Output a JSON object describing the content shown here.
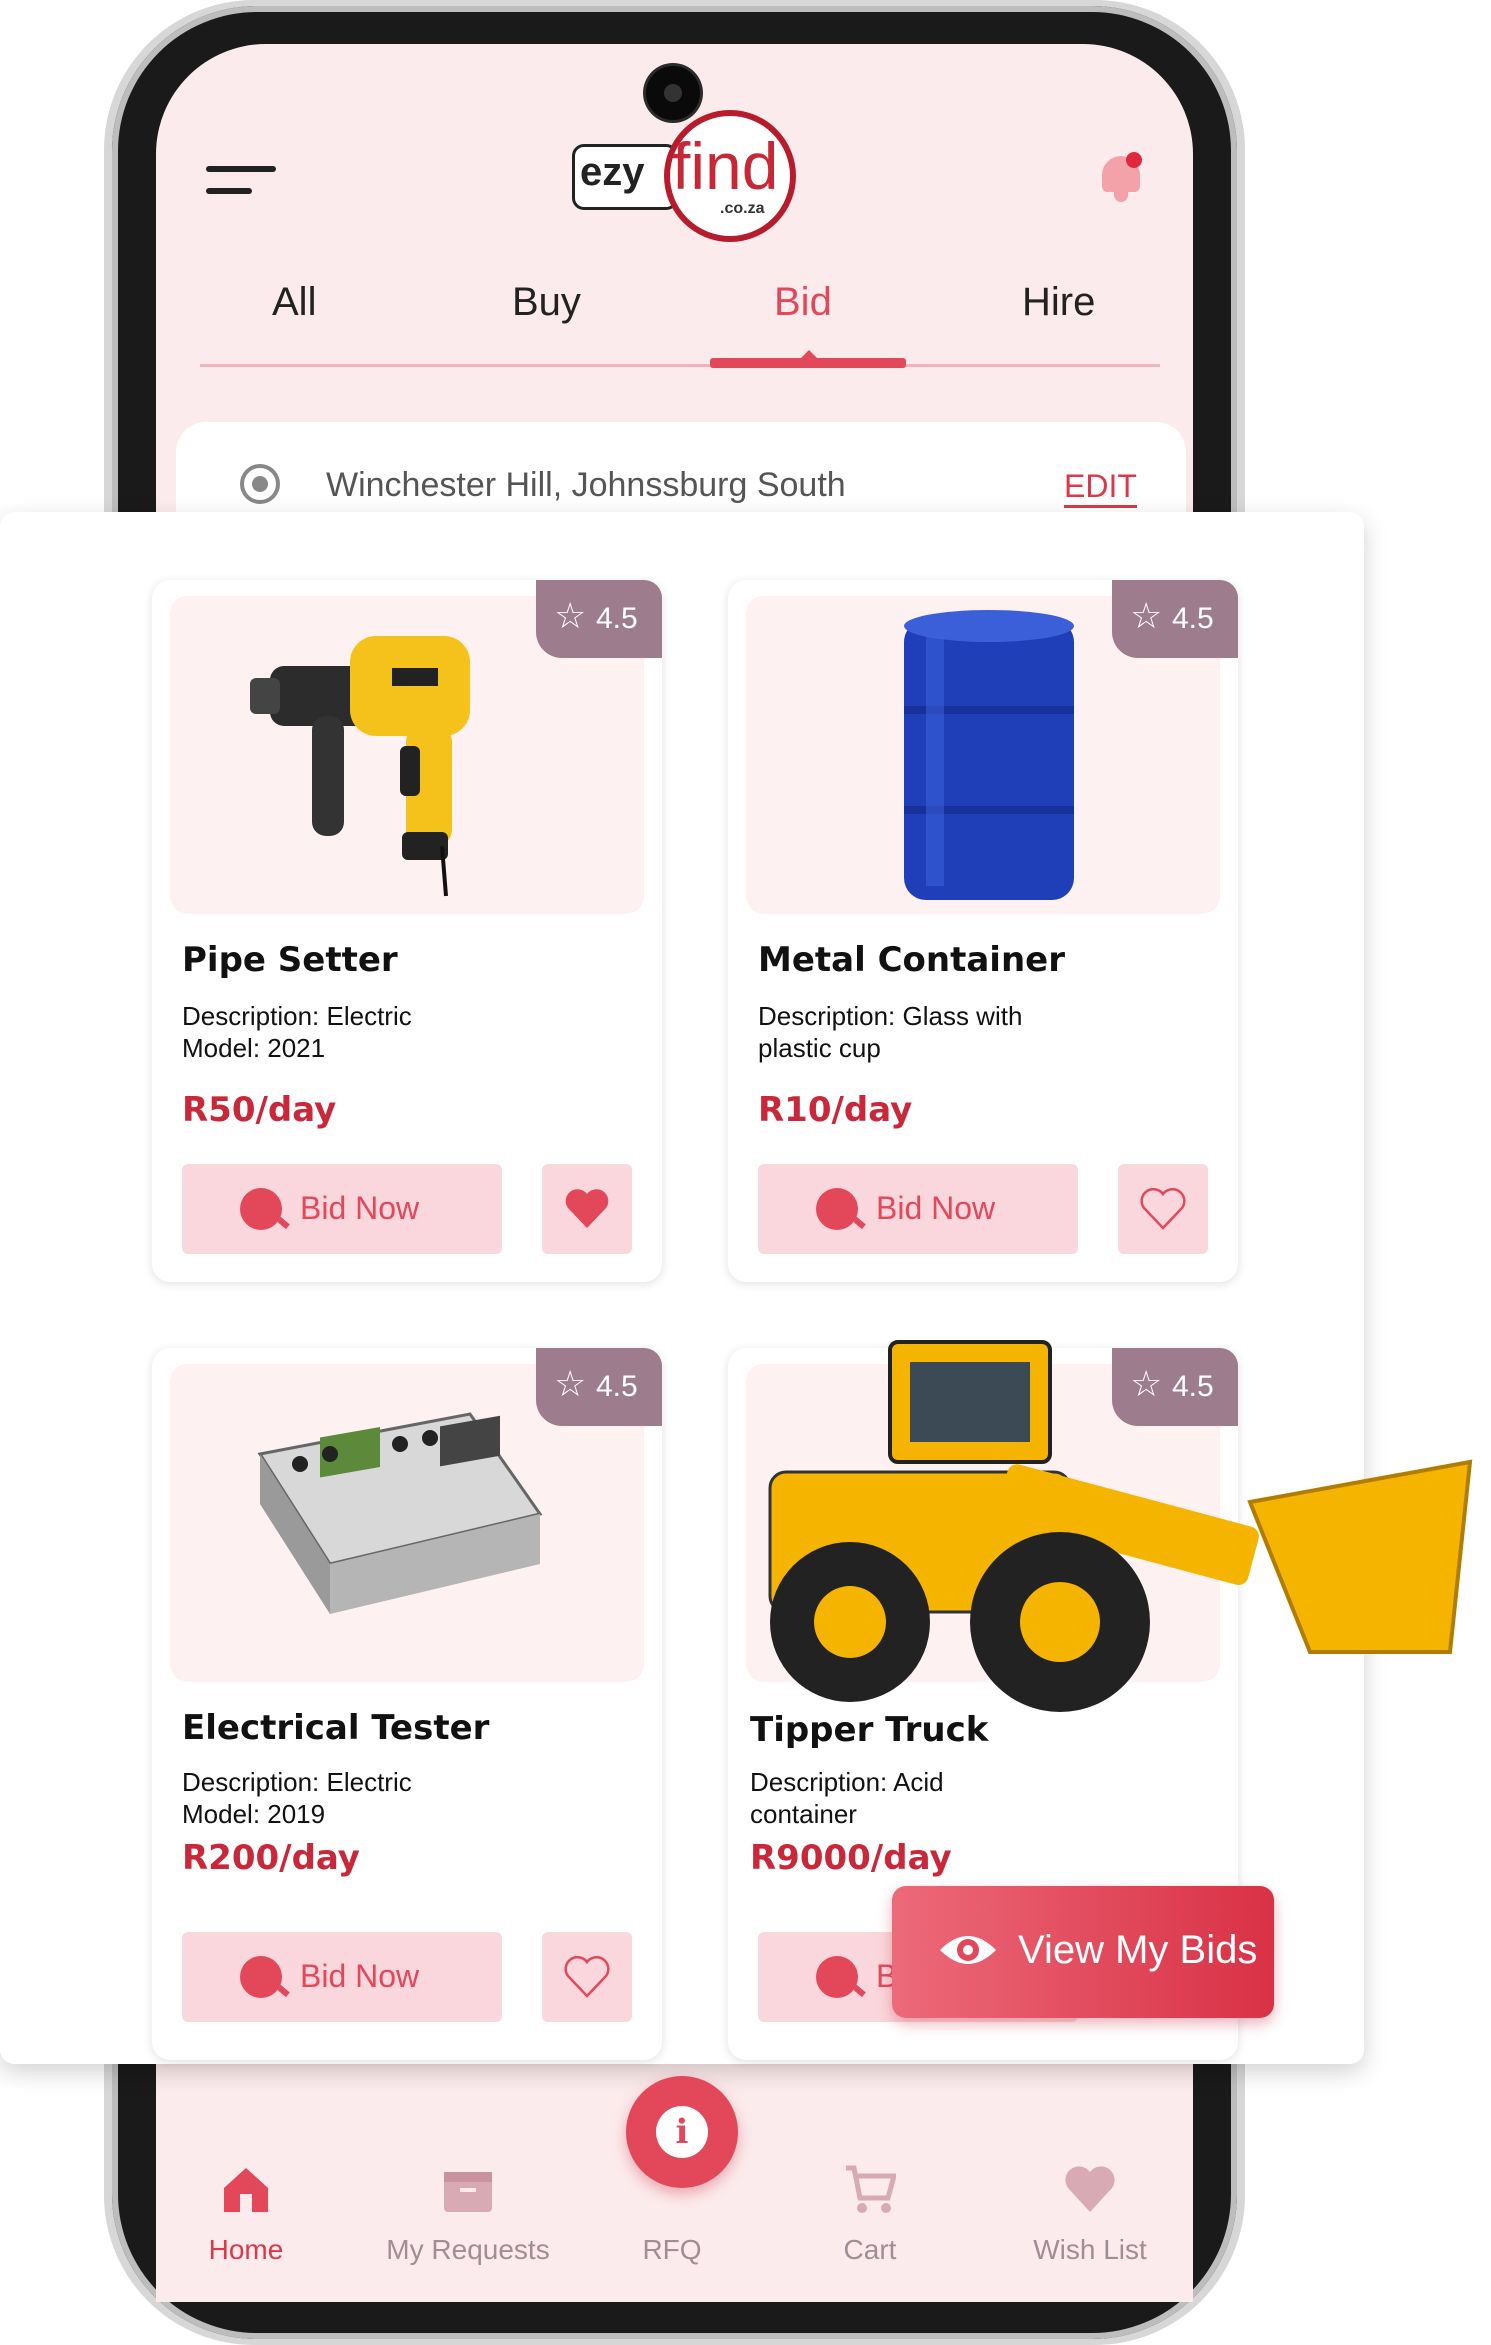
{
  "header": {
    "logo": {
      "ezy": "ezy",
      "find": "find",
      "coza": ".co.za"
    }
  },
  "tabs": [
    {
      "label": "All"
    },
    {
      "label": "Buy"
    },
    {
      "label": "Bid",
      "active": true
    },
    {
      "label": "Hire"
    }
  ],
  "location": {
    "text": "Winchester Hill, Johnssburg South",
    "edit_label": "EDIT"
  },
  "products": [
    {
      "title": "Pipe Setter",
      "desc_line1": "Description: Electric",
      "desc_line2": "Model: 2021",
      "price": "R50/day",
      "rating": "4.5",
      "bid_label": "Bid Now",
      "favorited": true,
      "image_icon": "hammer-drill-icon"
    },
    {
      "title": "Metal Container",
      "desc_line1": "Description: Glass with",
      "desc_line2": "plastic cup",
      "price": "R10/day",
      "rating": "4.5",
      "bid_label": "Bid Now",
      "favorited": false,
      "image_icon": "barrel-icon"
    },
    {
      "title": "Electrical Tester",
      "desc_line1": "Description: Electric",
      "desc_line2": "Model: 2019",
      "price": "R200/day",
      "rating": "4.5",
      "bid_label": "Bid Now",
      "favorited": false,
      "image_icon": "electrical-tester-icon"
    },
    {
      "title": "Tipper Truck",
      "desc_line1": "Description: Acid",
      "desc_line2": "container",
      "price": "R9000/day",
      "rating": "4.5",
      "bid_label": "B",
      "favorited": false,
      "image_icon": "wheel-loader-icon"
    }
  ],
  "view_bids": {
    "label": "View My Bids"
  },
  "bottom_nav": [
    {
      "label": "Home",
      "icon": "home-icon",
      "active": true
    },
    {
      "label": "My Requests",
      "icon": "box-icon"
    },
    {
      "label": "RFQ",
      "icon": "info-icon"
    },
    {
      "label": "Cart",
      "icon": "cart-icon"
    },
    {
      "label": "Wish List",
      "icon": "heart-icon"
    }
  ],
  "colors": {
    "accent": "#e2485a",
    "price": "#c8283a",
    "rating_badge": "#9d7c8e",
    "screen_bg": "#fcebec"
  }
}
